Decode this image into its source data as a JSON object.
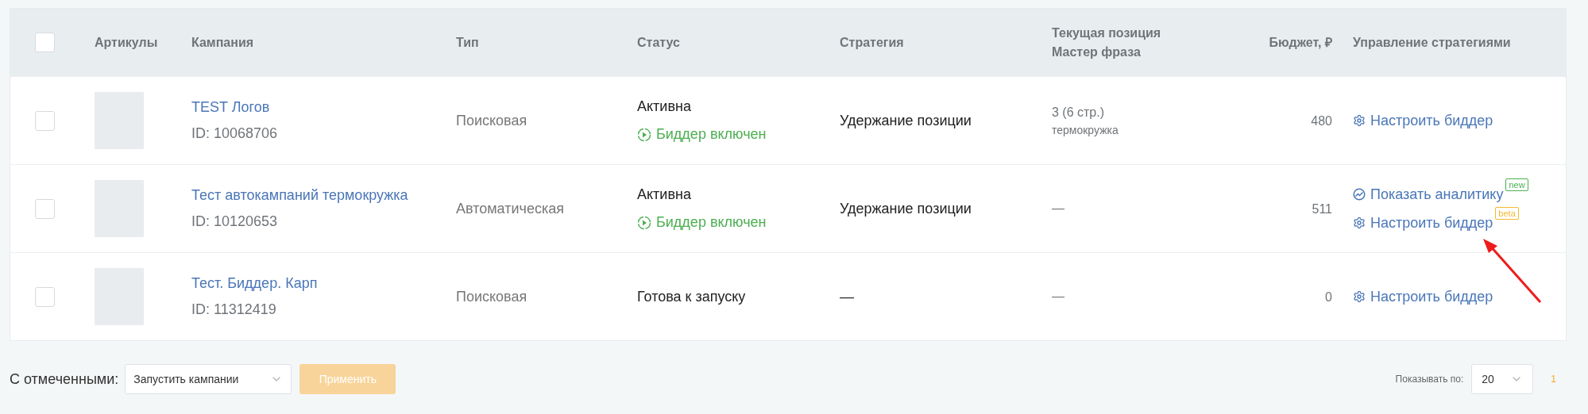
{
  "table": {
    "select_all": {
      "checked": false
    },
    "columns": [
      "Артикулы",
      "Кампания",
      "Тип",
      "Статус",
      "Стратегия",
      "Текущая позиция\nМастер фраза",
      "Бюджет, ₽",
      "Управление стратегиями"
    ],
    "rows": [
      {
        "checked": false,
        "campaign": "TEST Логов",
        "id": "ID: 10068706",
        "type": "Поисковая",
        "status": "Активна",
        "bidder": "Биддер включен",
        "strategy": "Удержание позиции",
        "position": "3 (6 стр.)",
        "phrase": "термокружка",
        "budget": "480",
        "actions": [
          {
            "kind": "settings",
            "label": "Настроить биддер"
          }
        ]
      },
      {
        "checked": false,
        "campaign": "Тест автокампаний термокружка",
        "id": "ID: 10120653",
        "type": "Автоматическая",
        "status": "Активна",
        "bidder": "Биддер включен",
        "strategy": "Удержание позиции",
        "position": "—",
        "budget": "511",
        "actions": [
          {
            "kind": "analytics",
            "label": "Показать аналитику",
            "badge": {
              "text": "new",
              "color": "#4caf50"
            }
          },
          {
            "kind": "settings",
            "label": "Настроить биддер",
            "badge": {
              "text": "beta",
              "color": "#f5b82e"
            }
          }
        ]
      },
      {
        "checked": false,
        "campaign": "Тест. Биддер. Карп",
        "id": "ID: 11312419",
        "type": "Поисковая",
        "status": "Готова к запуску",
        "strategy": "—",
        "position": "—",
        "budget": "0",
        "actions": [
          {
            "kind": "settings",
            "label": "Настроить биддер"
          }
        ]
      }
    ]
  },
  "annotation": {
    "kind": "arrow"
  },
  "footer": {
    "bulk_label": "С отмеченными:",
    "bulk_action": "Запустить кампании",
    "apply": {
      "label": "Применить",
      "disabled": true
    },
    "page_size_label": "Показывать по:",
    "page_size": "20",
    "pages": [
      {
        "label": "1",
        "selected": true
      }
    ]
  }
}
